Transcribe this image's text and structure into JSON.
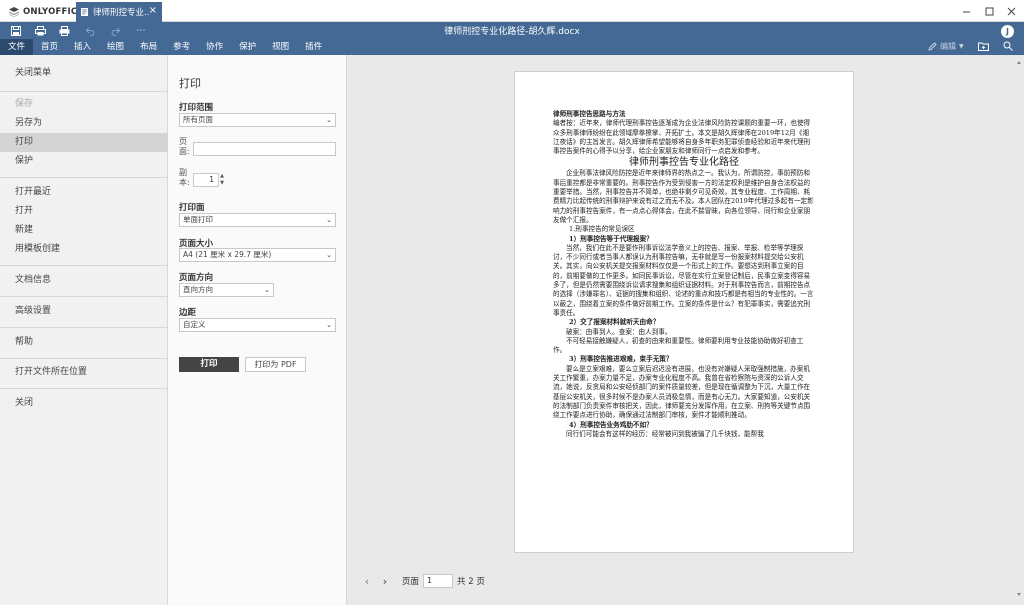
{
  "app": {
    "logo_text": "ONLYOFFICE",
    "tab_label": "律师刑控专业...",
    "document_title": "律师刑控专业化路径-胡久辉.docx",
    "user_initial": "J",
    "edit_mode_label": "编辑"
  },
  "menu": [
    "文件",
    "首页",
    "插入",
    "绘图",
    "布局",
    "参考",
    "协作",
    "保护",
    "视图",
    "插件"
  ],
  "file_menu": {
    "close": "关闭菜单",
    "save": "保存",
    "save_as": "另存为",
    "print": "打印",
    "protect": "保护",
    "open_recent": "打开最近",
    "open": "打开",
    "new": "新建",
    "create_from_template": "用模板创建",
    "doc_info": "文档信息",
    "advanced_settings": "高级设置",
    "help": "帮助",
    "open_location": "打开文件所在位置",
    "close_file": "关闭"
  },
  "print_panel": {
    "title": "打印",
    "range_label": "打印范围",
    "range_value": "所有页面",
    "pages_label": "页面:",
    "pages_value": "",
    "copies_label": "副本:",
    "copies_value": "1",
    "sides_label": "打印面",
    "sides_value": "单面打印",
    "size_label": "页面大小",
    "size_value": "A4 (21 厘米 x 29.7 厘米)",
    "orientation_label": "页面方向",
    "orientation_value": "直向方向",
    "margins_label": "边距",
    "margins_value": "自定义",
    "print_button": "打印",
    "pdf_button": "打印为 PDF"
  },
  "pager": {
    "label": "页面",
    "current": "1",
    "total": "共 2 页"
  },
  "document": {
    "heading": "律师刑事控告思路与方法",
    "intro": "编者按：近年来，律师代理刑事控告逐渐成为企业法律风险防控课题的重要一环，也使得众多刑事律师纷纷在此领域摩拳擦掌、开拓扩土。本文是胡久辉律师在2019年12月《湘江夜话》的主旨发言。胡久辉律师希望能够将自身多年职务犯罪侦查经验和近年来代理刑事控告案件的心得予以分享，给企业家朋友和律师同行一点启发和参考。",
    "main_title": "律师刑事控告专业化路径",
    "p1": "企业刑事法律风险防控是近年来律师界的热点之一。我认为，所谓防控，事前预防和事后重控都是非常重要的。刑事控告作为受到侵害一方的法定权利是维护自身合法权益的重要举措。当然，刑事控告并不简单，也绝非剩夕可见奇效，其专业程度、工作周期、耗费精力比起传统的刑事辩护来说有过之而无不及。本人团队在2019年代理过多起有一定影响力的刑事控告案件，有一点点心得体会，在此不揣冒昧，向各位领导、同行和企业家朋友做个汇报。",
    "s1": "1.刑事控告的常见误区",
    "s1_1": "1）刑事控告等于代理报案？",
    "p2": "当然，我们在此不是要作刑事诉讼法学意义上的控告、报案、举报、检举等学理探讨，不少同行或者当事人都误认为刑事控告嘛，无非就是写一份报案材料提交给公安机关。其实，向公安机关提交报案材料仅仅是一个形式上的工作。要想达到刑事立案的目的，前期要做的工作更多。如同民事诉讼，尽管在实行立案登记制后，民事立案变得容易多了，但是仍然需要围绕诉讼请求搜集和组织证据材料。对于刑事控告而言，前期控告点的选择（涉嫌罪名）、证据的搜集和组织、论述的重点和技巧都是有相当的专业性的。一言以蔽之，围绕着立案的条件做好前期工作。立案的条件是什么？有犯罪事实，需要追究刑事责任。",
    "s1_2": "2）交了报案材料就听天由命？",
    "p3": "破案：由事到人。查案：由人到事。",
    "p4": "不可轻易接触嫌疑人，初查的由来和重要性。律师要利用专业技能协助做好初查工作。",
    "s1_3": "3）刑事控告推进艰难，束手无策？",
    "p5": "要么是立案艰难，要么立案后迟迟没有进展，也没有对嫌疑人采取强制措施，办案机关工作繁重，办案力量不足，办案专业化程度不高。我曾在省检察院与资深的公诉人交流，她说，反贪局和公安经侦部门的案件质量较差，但是现在循调整为下沉，大量工作在基层公安机关，很多时候不是办案人员消极怠情，而是有心无力。大家要知道，公安机关的法制部门负责案件审核把关，因此，律师要充分发挥作用，在立案、刑拘等关键节点围绕工作要点进行协助，确保通过法制部门审核，案件才能顺利推动。",
    "s1_4": "4）刑事控告业务鸡肋不如？",
    "p6": "同行们可能会有这样的经历：经常被问到我被骗了几千块钱，能帮我"
  }
}
